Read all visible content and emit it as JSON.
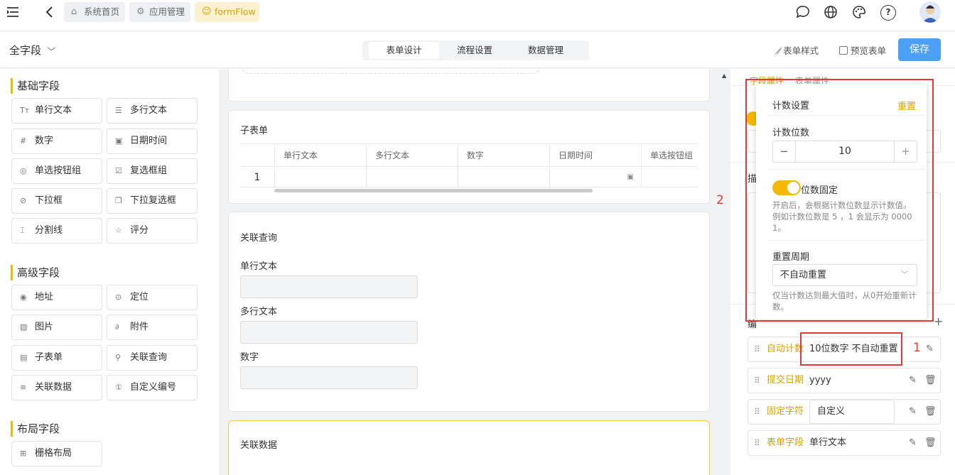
{
  "topbar": {
    "crumbs": [
      "系统首页",
      "应用管理",
      "formFlow"
    ],
    "icons": [
      "menu-fold-icon",
      "back-icon",
      "chat-icon",
      "globe-icon",
      "palette-icon",
      "help-icon",
      "avatar"
    ]
  },
  "toolbar": {
    "form_name": "全字段",
    "tabs": [
      "表单设计",
      "流程设置",
      "数据管理"
    ],
    "active_tab": "表单设计",
    "form_style": "表单样式",
    "preview": "预览表单",
    "save": "保存"
  },
  "left": {
    "basic_title": "基础字段",
    "basic": [
      "单行文本",
      "多行文本",
      "数字",
      "日期时间",
      "单选按钮组",
      "复选框组",
      "下拉框",
      "下拉复选框",
      "分割线",
      "评分"
    ],
    "advanced_title": "高级字段",
    "advanced": [
      "地址",
      "定位",
      "图片",
      "附件",
      "子表单",
      "关联查询",
      "关联数据",
      "自定义编号"
    ],
    "layout_title": "布局字段",
    "layout": [
      "栅格布局"
    ]
  },
  "canvas": {
    "subform": {
      "title": "子表单",
      "headers": [
        "单行文本",
        "多行文本",
        "数字",
        "日期时间",
        "单选按钮组"
      ],
      "row_index": "1"
    },
    "lookup": {
      "title": "关联查询",
      "fields": [
        "单行文本",
        "多行文本",
        "数字"
      ]
    },
    "linked": {
      "title": "关联数据"
    }
  },
  "right": {
    "tabs_partial": [
      "字段属性",
      "表单属性"
    ],
    "labels_partial": [
      "描",
      "编"
    ],
    "rules": [
      {
        "name": "自动计数",
        "value": "10位数字 不自动重置"
      },
      {
        "name": "提交日期",
        "value": "yyyy"
      },
      {
        "name": "固定字符",
        "value": "自定义"
      },
      {
        "name": "表单字段",
        "value": "单行文本"
      }
    ]
  },
  "popover": {
    "title": "计数设置",
    "reset": "重置",
    "digits_label": "计数位数",
    "digits_value": "10",
    "minus": "−",
    "plus": "+",
    "fixed_label": "位数固定",
    "fixed_on": true,
    "fixed_help": "开启后，会根据计数位数显示计数值。例如计数位数是 5 ，1 会显示为 0000 1。",
    "period_label": "重置周期",
    "period_value": "不自动重置",
    "period_help": "仅当计数达到最大值时，从0开始重新计数。"
  },
  "annotations": {
    "one": "1",
    "two": "2"
  },
  "colors": {
    "accent": "#f5b800",
    "primary": "#4b9ff5",
    "annotation": "#e53935"
  }
}
